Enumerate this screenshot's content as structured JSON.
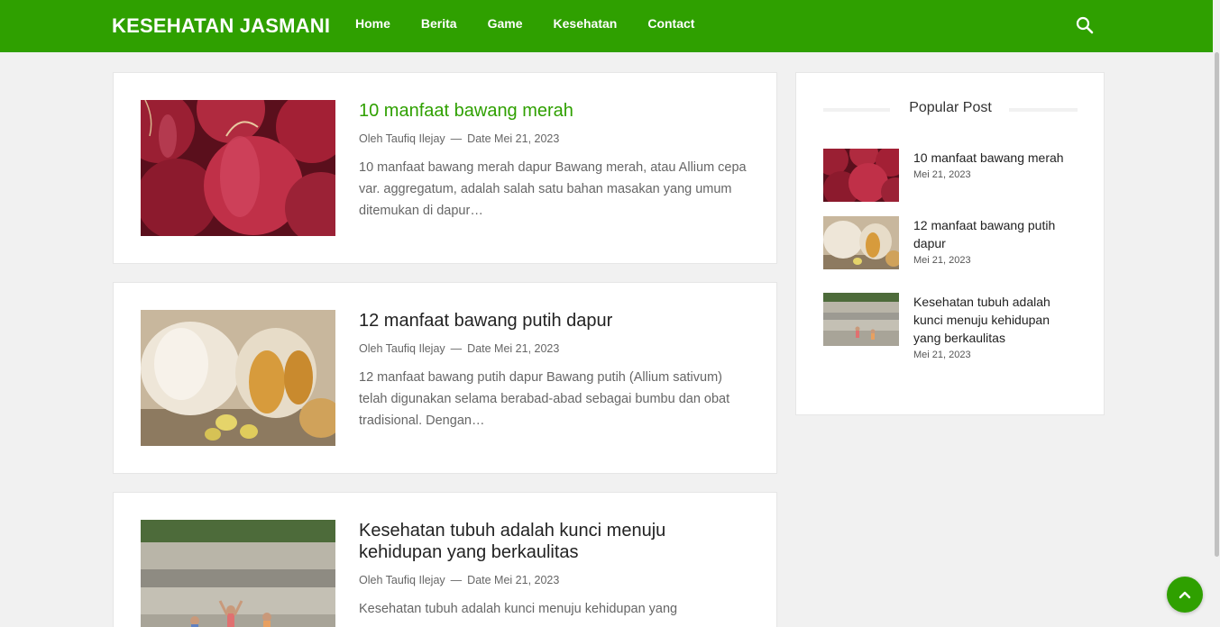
{
  "site": {
    "brand": "KESEHATAN JASMANI",
    "nav": [
      "Home",
      "Berita",
      "Game",
      "Kesehatan",
      "Contact"
    ],
    "accent_color": "#2fa000",
    "search_icon": "search-icon"
  },
  "posts": [
    {
      "title": "10 manfaat bawang merah",
      "author": "Oleh Taufiq Ilejay",
      "separator": "—",
      "date": "Date Mei 21, 2023",
      "excerpt": "10 manfaat bawang merah dapur Bawang merah, atau Allium cepa var. aggregatum, adalah salah satu bahan masakan yang umum ditemukan di dapur…",
      "image": "red-onions-photo"
    },
    {
      "title": "12 manfaat bawang putih dapur",
      "author": "Oleh Taufiq Ilejay",
      "separator": "—",
      "date": "Date Mei 21, 2023",
      "excerpt": "12 manfaat bawang putih dapur Bawang putih (Allium sativum) telah digunakan selama berabad-abad sebagai bumbu dan obat tradisional. Dengan…",
      "image": "garlic-photo"
    },
    {
      "title": "Kesehatan tubuh adalah kunci menuju kehidupan yang berkaulitas",
      "author": "Oleh Taufiq Ilejay",
      "separator": "—",
      "date": "Date Mei 21, 2023",
      "excerpt": "Kesehatan tubuh adalah kunci menuju kehidupan yang",
      "image": "yoga-group-photo"
    }
  ],
  "sidebar": {
    "widget_title": "Popular Post",
    "items": [
      {
        "title": "10 manfaat bawang merah",
        "date": "Mei 21, 2023"
      },
      {
        "title": "12 manfaat bawang putih dapur",
        "date": "Mei 21, 2023"
      },
      {
        "title": "Kesehatan tubuh adalah kunci menuju kehidupan yang berkaulitas",
        "date": "Mei 21, 2023"
      }
    ]
  },
  "back_to_top_icon": "chevron-up-icon"
}
